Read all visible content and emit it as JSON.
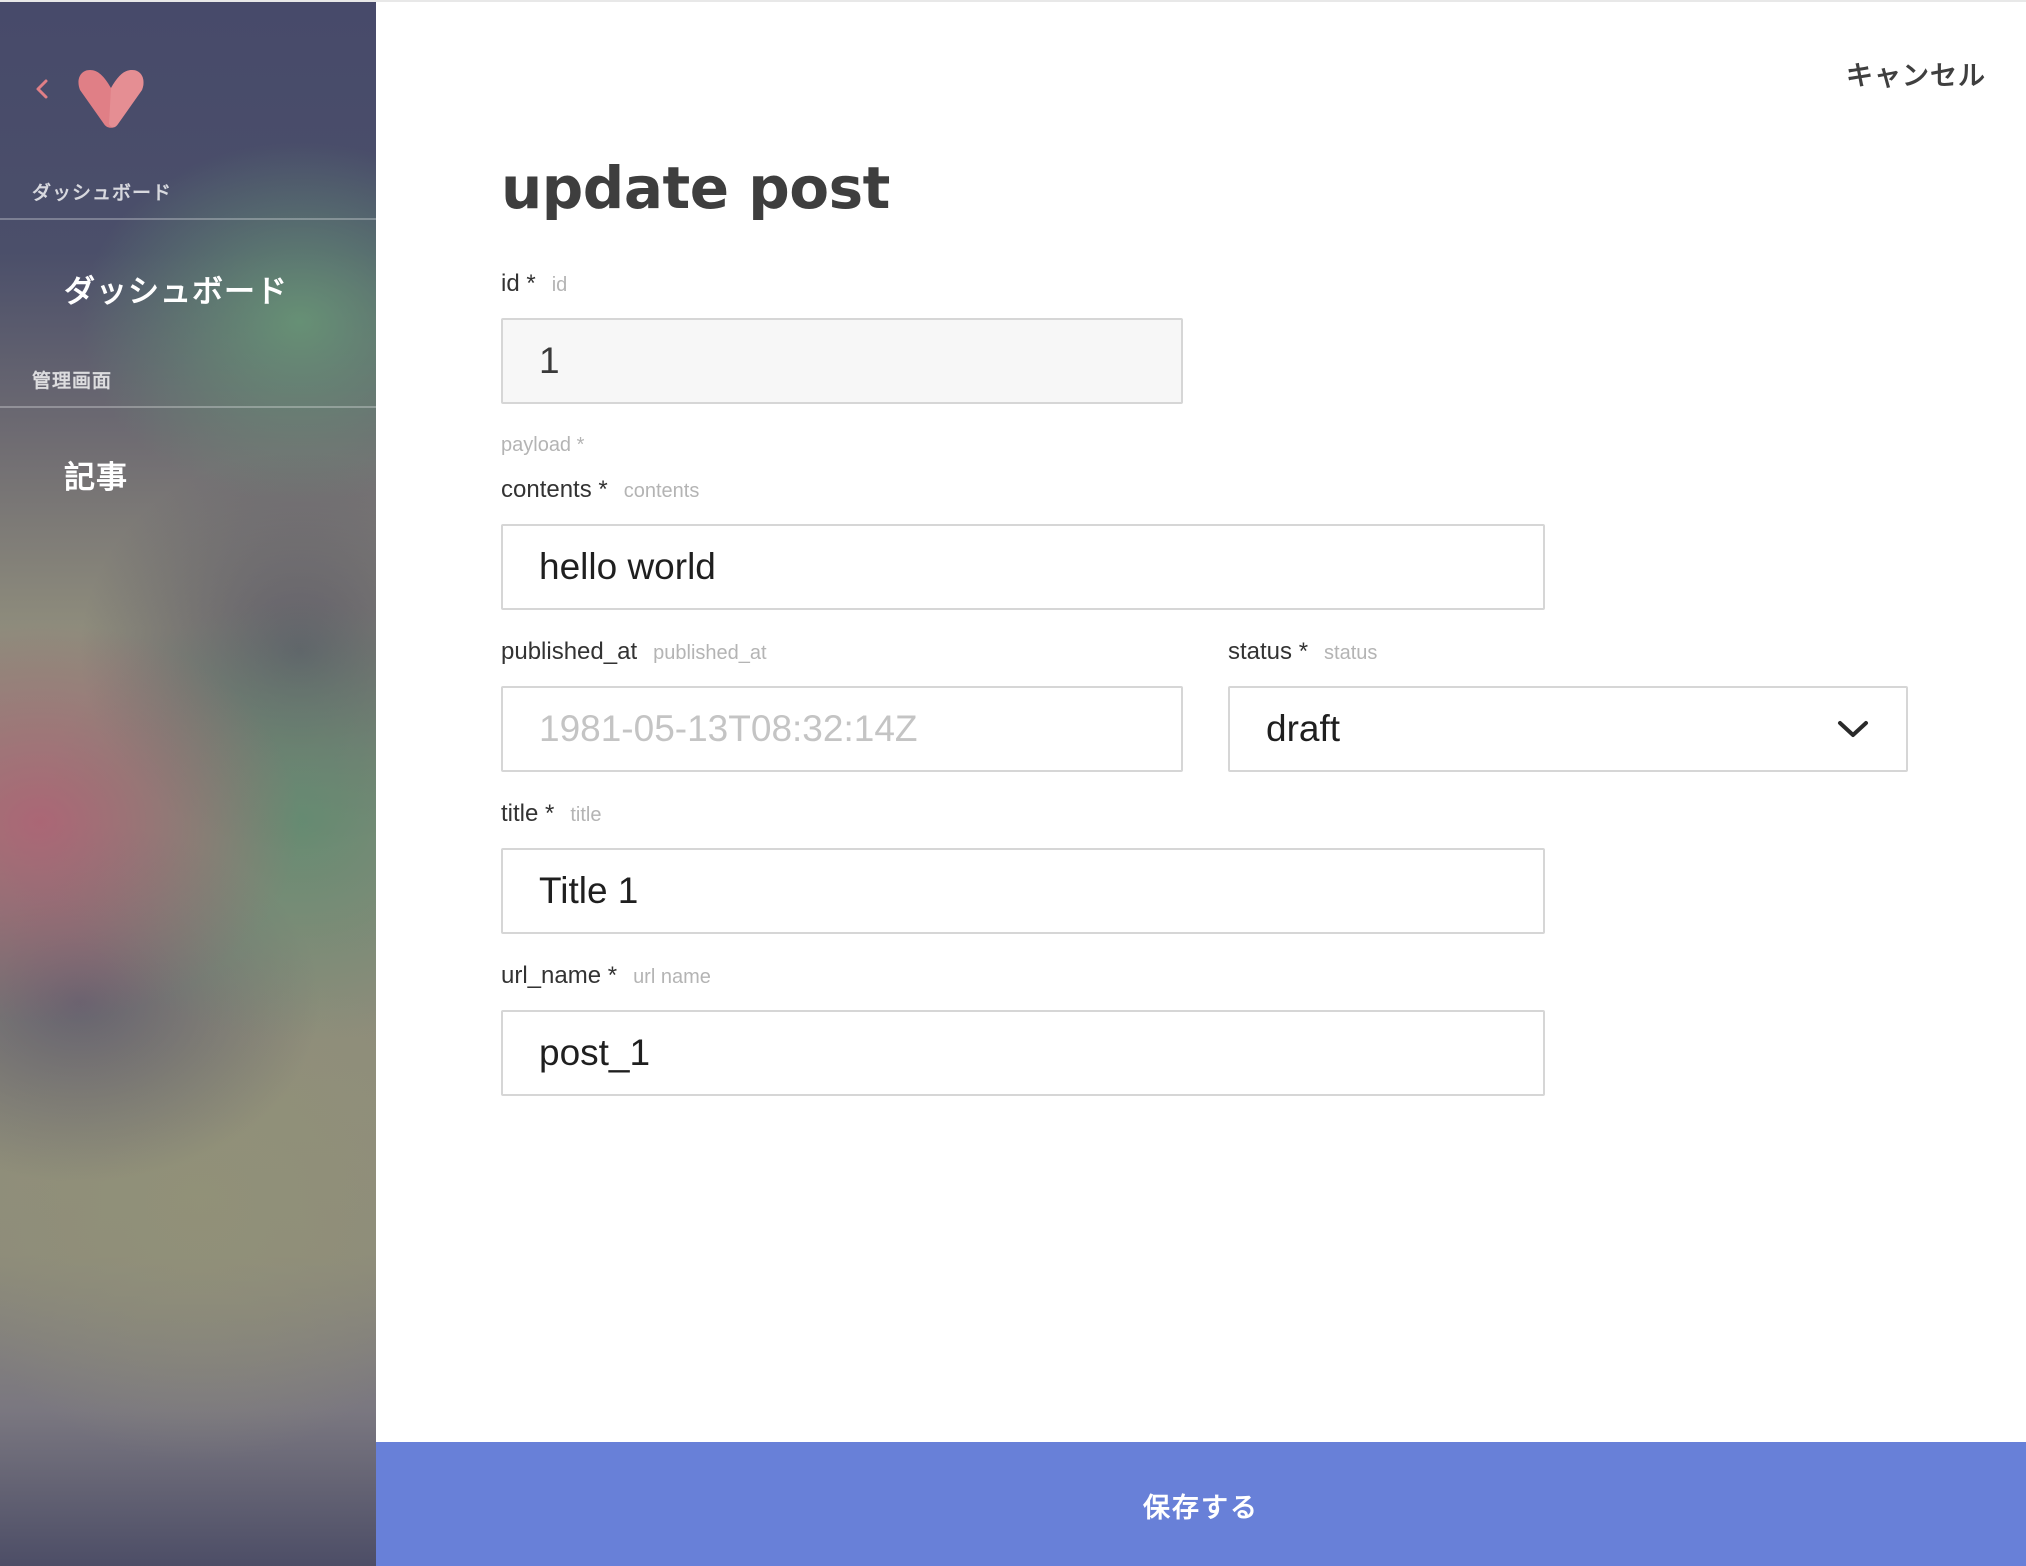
{
  "sidebar": {
    "back_icon": "chevron-left-icon",
    "logo_icon": "heart-v-logo",
    "section_dashboard": "ダッシュボード",
    "item_dashboard": "ダッシュボード",
    "section_admin": "管理画面",
    "item_articles": "記事"
  },
  "header": {
    "cancel_label": "キャンセル"
  },
  "page": {
    "title": "update post"
  },
  "form": {
    "id": {
      "label": "id *",
      "hint": "id",
      "value": "1"
    },
    "group_label": "payload *",
    "contents": {
      "label": "contents *",
      "hint": "contents",
      "value": "hello world"
    },
    "published_at": {
      "label": "published_at",
      "hint": "published_at",
      "placeholder": "1981-05-13T08:32:14Z"
    },
    "status": {
      "label": "status *",
      "hint": "status",
      "value": "draft"
    },
    "title": {
      "label": "title *",
      "hint": "title",
      "value": "Title 1"
    },
    "url_name": {
      "label": "url_name *",
      "hint": "url name",
      "value": "post_1"
    }
  },
  "footer": {
    "save_label": "保存する"
  },
  "colors": {
    "accent": "#6880d8",
    "logo": "#e07f86",
    "text_dark": "#3e3e3e",
    "hint": "#b4b4b4"
  }
}
